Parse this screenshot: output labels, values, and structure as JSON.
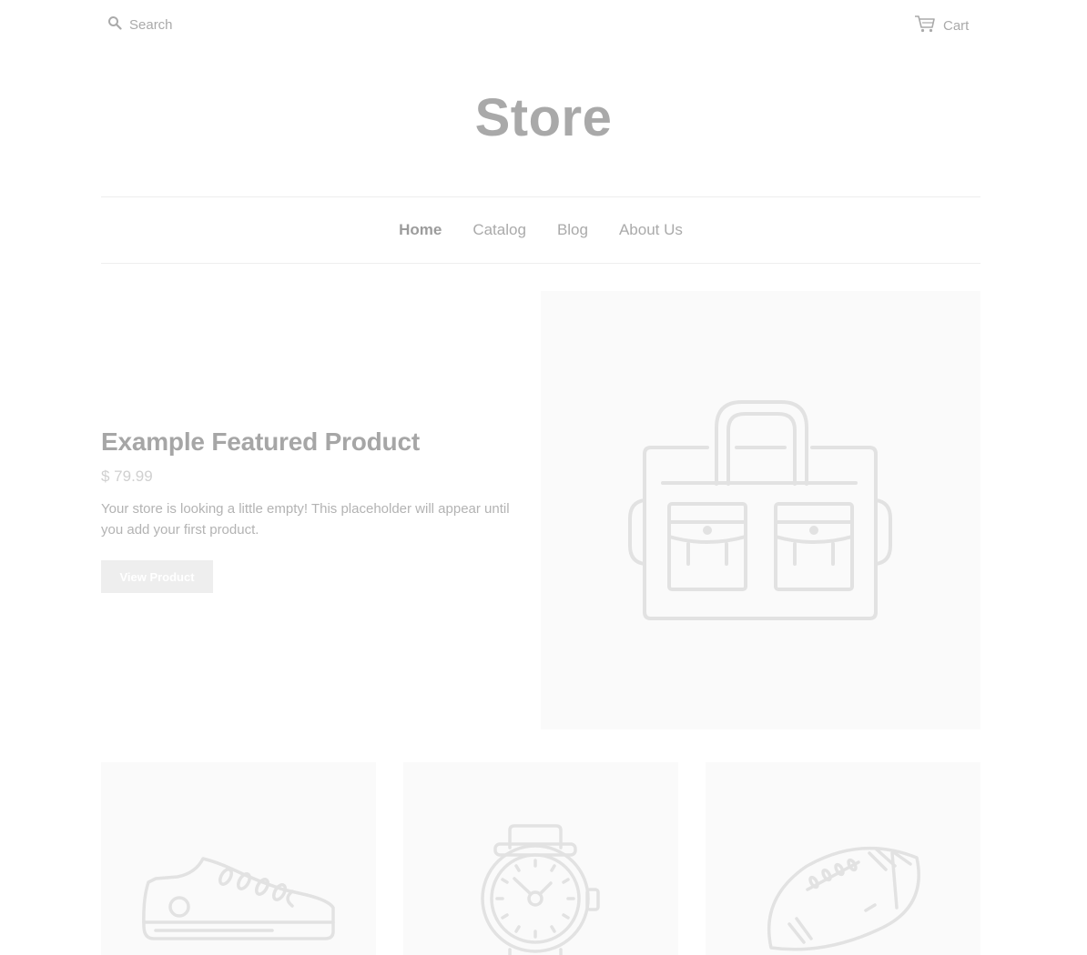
{
  "header": {
    "search_placeholder": "Search",
    "search_icon": "search-icon",
    "cart_label": "Cart",
    "cart_icon": "cart-icon",
    "logo": "Store"
  },
  "nav": {
    "items": [
      {
        "label": "Home",
        "active": true
      },
      {
        "label": "Catalog",
        "active": false
      },
      {
        "label": "Blog",
        "active": false
      },
      {
        "label": "About Us",
        "active": false
      }
    ]
  },
  "featured": {
    "title": "Example Featured Product",
    "price": "$ 79.99",
    "description": "Your store is looking a little empty! This placeholder will appear until you add your first product.",
    "button_label": "View Product",
    "image_icon": "bag-placeholder-icon"
  },
  "products": [
    {
      "icon": "sneaker-placeholder-icon"
    },
    {
      "icon": "watch-placeholder-icon"
    },
    {
      "icon": "football-placeholder-icon"
    }
  ],
  "colors": {
    "text": "#aaaaaa",
    "placeholder_bg": "#fafafa",
    "icon_stroke": "#e2e2e2",
    "button_bg": "#eeeeee",
    "border": "#eeeeee"
  }
}
